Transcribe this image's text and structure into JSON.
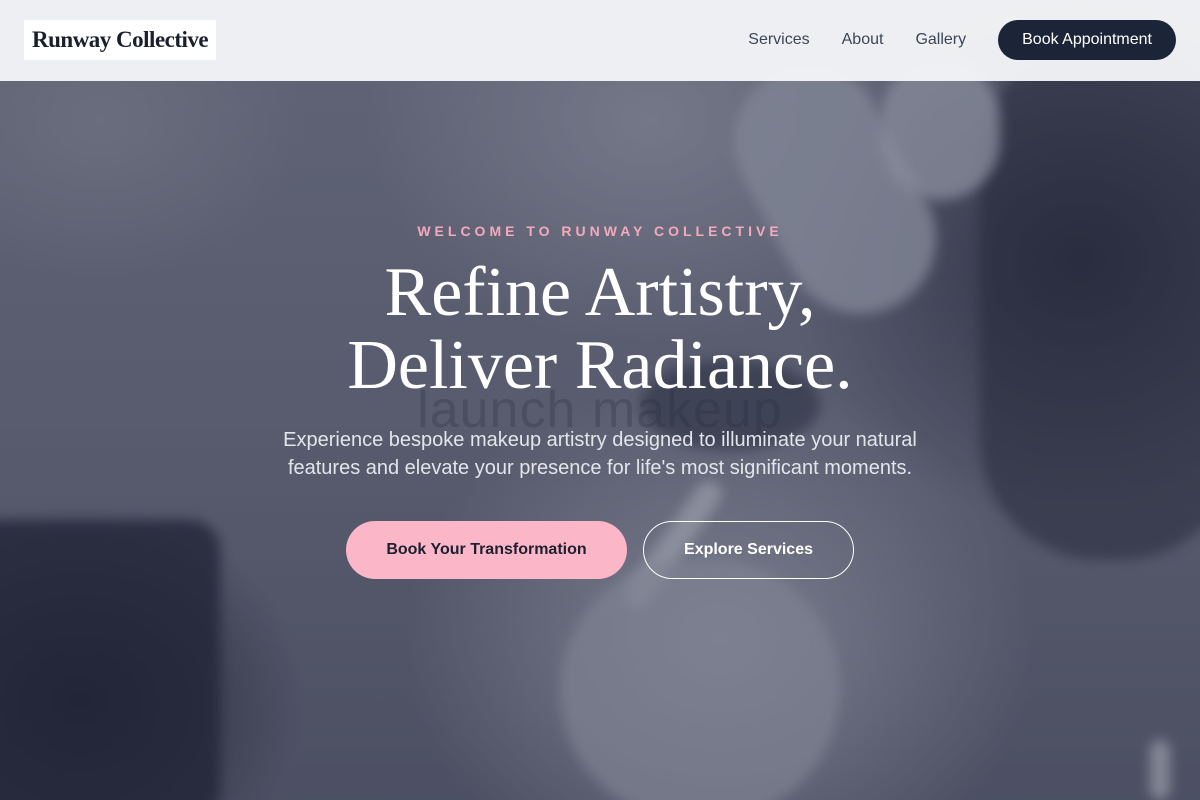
{
  "header": {
    "logo_text": "Runway Collective",
    "nav": [
      {
        "label": "Services"
      },
      {
        "label": "About"
      },
      {
        "label": "Gallery"
      }
    ],
    "cta_label": "Book Appointment"
  },
  "hero": {
    "eyebrow": "WELCOME TO RUNWAY COLLECTIVE",
    "headline_line1": "Refine Artistry,",
    "headline_line2": "Deliver Radiance.",
    "background_text": "launch makeup",
    "subtext": "Experience bespoke makeup artistry designed to illuminate your natural features and elevate your presence for life's most significant moments.",
    "primary_button": "Book Your Transformation",
    "secondary_button": "Explore Services",
    "background_image": "blurred close-up of makeup application on eye"
  },
  "colors": {
    "accent_pink": "#fbb6c8",
    "eyebrow_pink": "#f4a9bd",
    "navy": "#1c2537",
    "header_bg": "#f4f5f7"
  }
}
